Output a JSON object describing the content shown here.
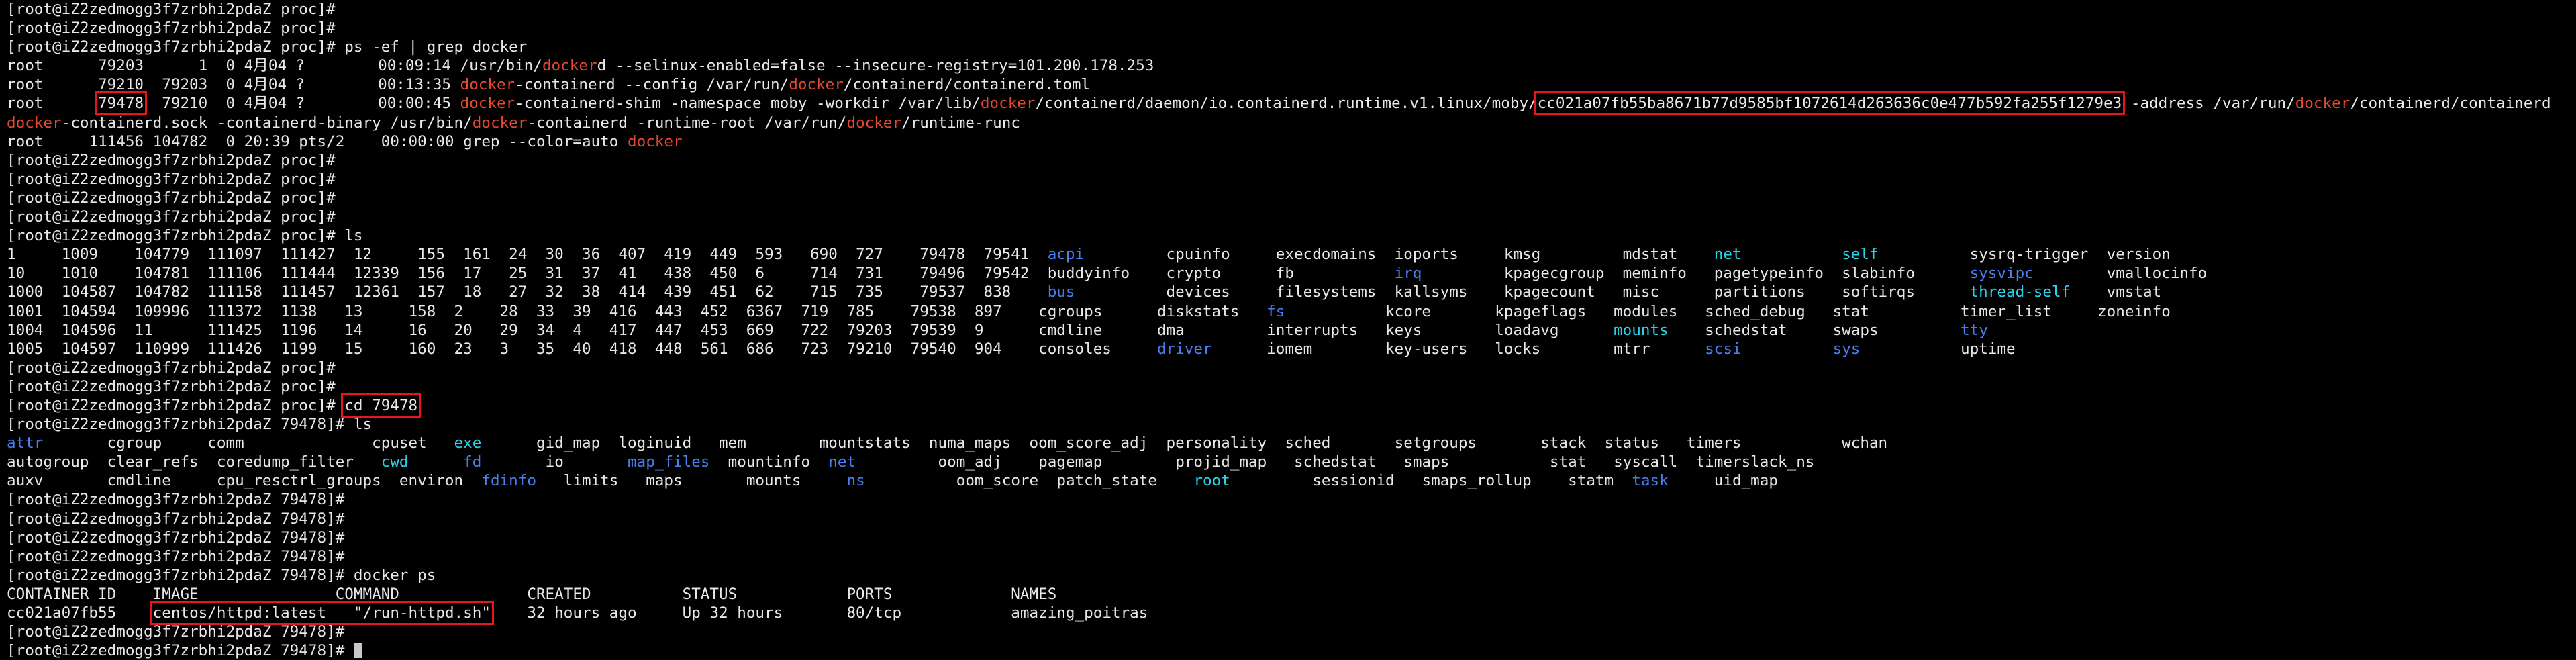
{
  "terminal": {
    "lines": [
      [
        {
          "t": "[root@iZ2zedmogg3f7zrbhi2pdaZ proc]#"
        }
      ],
      [
        {
          "t": "[root@iZ2zedmogg3f7zrbhi2pdaZ proc]#"
        }
      ],
      [
        {
          "t": "[root@iZ2zedmogg3f7zrbhi2pdaZ proc]# ps -ef | grep docker"
        }
      ],
      [
        {
          "t": "root      79203      1  0 4月04 ?        00:09:14 /usr/bin/"
        },
        {
          "t": "docker",
          "c": "red"
        },
        {
          "t": "d --selinux-enabled=false --insecure-registry=101.200.178.253"
        }
      ],
      [
        {
          "t": "root      79210  79203  0 4月04 ?        00:13:35 "
        },
        {
          "t": "docker",
          "c": "red"
        },
        {
          "t": "-containerd --config /var/run/"
        },
        {
          "t": "docker",
          "c": "red"
        },
        {
          "t": "/containerd/containerd.toml"
        }
      ],
      [
        {
          "t": "root      "
        },
        {
          "t": "79478",
          "hl": true
        },
        {
          "t": "  79210  0 4月04 ?        00:00:45 "
        },
        {
          "t": "docker",
          "c": "red"
        },
        {
          "t": "-containerd-shim -namespace moby -workdir /var/lib/"
        },
        {
          "t": "docker",
          "c": "red"
        },
        {
          "t": "/containerd/daemon/io.containerd.runtime.v1.linux/moby/"
        },
        {
          "t": "cc021a07fb55ba8671b77d9585bf1072614d263636c0e477b592fa255f1279e3",
          "hl": true
        },
        {
          "t": " -address /var/run/"
        },
        {
          "t": "docker",
          "c": "red"
        },
        {
          "t": "/containerd/containerd"
        }
      ],
      [
        {
          "t": "docker",
          "c": "red"
        },
        {
          "t": "-containerd.sock -containerd-binary /usr/bin/"
        },
        {
          "t": "docker",
          "c": "red"
        },
        {
          "t": "-containerd -runtime-root /var/run/"
        },
        {
          "t": "docker",
          "c": "red"
        },
        {
          "t": "/runtime-runc"
        }
      ],
      [
        {
          "t": "root     111456 104782  0 20:39 pts/2    00:00:00 grep --color=auto "
        },
        {
          "t": "docker",
          "c": "red"
        }
      ],
      [
        {
          "t": "[root@iZ2zedmogg3f7zrbhi2pdaZ proc]#"
        }
      ],
      [
        {
          "t": "[root@iZ2zedmogg3f7zrbhi2pdaZ proc]#"
        }
      ],
      [
        {
          "t": "[root@iZ2zedmogg3f7zrbhi2pdaZ proc]#"
        }
      ],
      [
        {
          "t": "[root@iZ2zedmogg3f7zrbhi2pdaZ proc]#"
        }
      ],
      [
        {
          "t": "[root@iZ2zedmogg3f7zrbhi2pdaZ proc]# ls"
        }
      ],
      [
        {
          "t": "1     1009    104779  111097  111427  12     155  161  24  30  36  407  419  449  593   690  727    79478  79541  "
        },
        {
          "t": "acpi",
          "c": "blue"
        },
        {
          "t": "         cpuinfo     execdomains  ioports     kmsg         mdstat    "
        },
        {
          "t": "net",
          "c": "cyan"
        },
        {
          "t": "           "
        },
        {
          "t": "self",
          "c": "cyan"
        },
        {
          "t": "          sysrq-trigger  version"
        }
      ],
      [
        {
          "t": "10    1010    104781  111106  111444  12339  156  17   25  31  37  41   438  450  6     714  731    79496  79542  buddyinfo    crypto      fb           "
        },
        {
          "t": "irq",
          "c": "blue"
        },
        {
          "t": "         kpagecgroup  meminfo   pagetypeinfo  slabinfo      "
        },
        {
          "t": "sysvipc",
          "c": "blue"
        },
        {
          "t": "        vmallocinfo"
        }
      ],
      [
        {
          "t": "1000  104587  104782  111158  111457  12361  157  18   27  32  38  414  439  451  62    715  735    79537  838    "
        },
        {
          "t": "bus",
          "c": "blue"
        },
        {
          "t": "          devices     filesystems  kallsyms    kpagecount   misc      partitions    softirqs      "
        },
        {
          "t": "thread-self",
          "c": "cyan"
        },
        {
          "t": "    vmstat"
        }
      ],
      [
        {
          "t": "1001  104594  109996  111372  1138   13     158  2    28  33  39  416  443  452  6367  719  785    79538  897    cgroups      diskstats   "
        },
        {
          "t": "fs",
          "c": "blue"
        },
        {
          "t": "           kcore       kpageflags   modules   sched_debug   stat          timer_list     zoneinfo"
        }
      ],
      [
        {
          "t": "1004  104596  11      111425  1196   14     16   20   29  34  4   417  447  453  669   722  79203  79539  9      cmdline      dma         interrupts   keys        loadavg      "
        },
        {
          "t": "mounts",
          "c": "cyan"
        },
        {
          "t": "    schedstat     swaps         "
        },
        {
          "t": "tty",
          "c": "blue"
        }
      ],
      [
        {
          "t": "1005  104597  110999  111426  1199   15     160  23   3   35  40  418  448  561  686   723  79210  79540  904    consoles     "
        },
        {
          "t": "driver",
          "c": "blue"
        },
        {
          "t": "      iomem        key-users   locks        mtrr      "
        },
        {
          "t": "scsi",
          "c": "blue"
        },
        {
          "t": "          "
        },
        {
          "t": "sys",
          "c": "blue"
        },
        {
          "t": "           uptime"
        }
      ],
      [
        {
          "t": "[root@iZ2zedmogg3f7zrbhi2pdaZ proc]#"
        }
      ],
      [
        {
          "t": "[root@iZ2zedmogg3f7zrbhi2pdaZ proc]#"
        }
      ],
      [
        {
          "t": "[root@iZ2zedmogg3f7zrbhi2pdaZ proc]# "
        },
        {
          "t": "cd 79478",
          "hl": true
        }
      ],
      [
        {
          "t": "[root@iZ2zedmogg3f7zrbhi2pdaZ 79478]# ls"
        }
      ],
      [
        {
          "t": "attr",
          "c": "blue"
        },
        {
          "t": "       cgroup     comm              cpuset   "
        },
        {
          "t": "exe",
          "c": "cyan"
        },
        {
          "t": "      gid_map  loginuid   mem        mountstats  numa_maps  oom_score_adj  personality  sched       setgroups       stack  status   timers           wchan"
        }
      ],
      [
        {
          "t": "autogroup  clear_refs  coredump_filter   "
        },
        {
          "t": "cwd",
          "c": "cyan"
        },
        {
          "t": "      "
        },
        {
          "t": "fd",
          "c": "blue"
        },
        {
          "t": "       io       "
        },
        {
          "t": "map_files",
          "c": "blue"
        },
        {
          "t": "  mountinfo  "
        },
        {
          "t": "net",
          "c": "blue"
        },
        {
          "t": "         oom_adj    pagemap        projid_map   schedstat   smaps           stat   syscall  timerslack_ns"
        }
      ],
      [
        {
          "t": "auxv       cmdline     cpu_resctrl_groups  environ  "
        },
        {
          "t": "fdinfo",
          "c": "blue"
        },
        {
          "t": "   limits   maps       mounts     "
        },
        {
          "t": "ns",
          "c": "blue"
        },
        {
          "t": "          oom_score  patch_state    "
        },
        {
          "t": "root",
          "c": "cyan"
        },
        {
          "t": "         sessionid   smaps_rollup    statm  "
        },
        {
          "t": "task",
          "c": "blue"
        },
        {
          "t": "     uid_map"
        }
      ],
      [
        {
          "t": "[root@iZ2zedmogg3f7zrbhi2pdaZ 79478]#"
        }
      ],
      [
        {
          "t": "[root@iZ2zedmogg3f7zrbhi2pdaZ 79478]#"
        }
      ],
      [
        {
          "t": "[root@iZ2zedmogg3f7zrbhi2pdaZ 79478]#"
        }
      ],
      [
        {
          "t": "[root@iZ2zedmogg3f7zrbhi2pdaZ 79478]#"
        }
      ],
      [
        {
          "t": "[root@iZ2zedmogg3f7zrbhi2pdaZ 79478]# docker ps"
        }
      ],
      [
        {
          "t": "CONTAINER ID    IMAGE               COMMAND              CREATED          STATUS            PORTS             NAMES"
        }
      ],
      [
        {
          "t": "cc021a07fb55    "
        },
        {
          "t": "centos/httpd:latest   \"/run-httpd.sh\"",
          "hl": true
        },
        {
          "t": "    32 hours ago     Up 32 hours       80/tcp            amazing_poitras"
        }
      ],
      [
        {
          "t": "[root@iZ2zedmogg3f7zrbhi2pdaZ 79478]#"
        }
      ],
      [
        {
          "t": "[root@iZ2zedmogg3f7zrbhi2pdaZ 79478]# "
        },
        {
          "t": "",
          "cursor": true
        }
      ]
    ]
  },
  "colors": {
    "background": "#000000",
    "text": "#e8e8e8",
    "keyword_red": "#e14a2f",
    "dir_blue": "#4a7ff0",
    "link_cyan": "#28d3ea",
    "highlight_box": "#e8161c"
  }
}
